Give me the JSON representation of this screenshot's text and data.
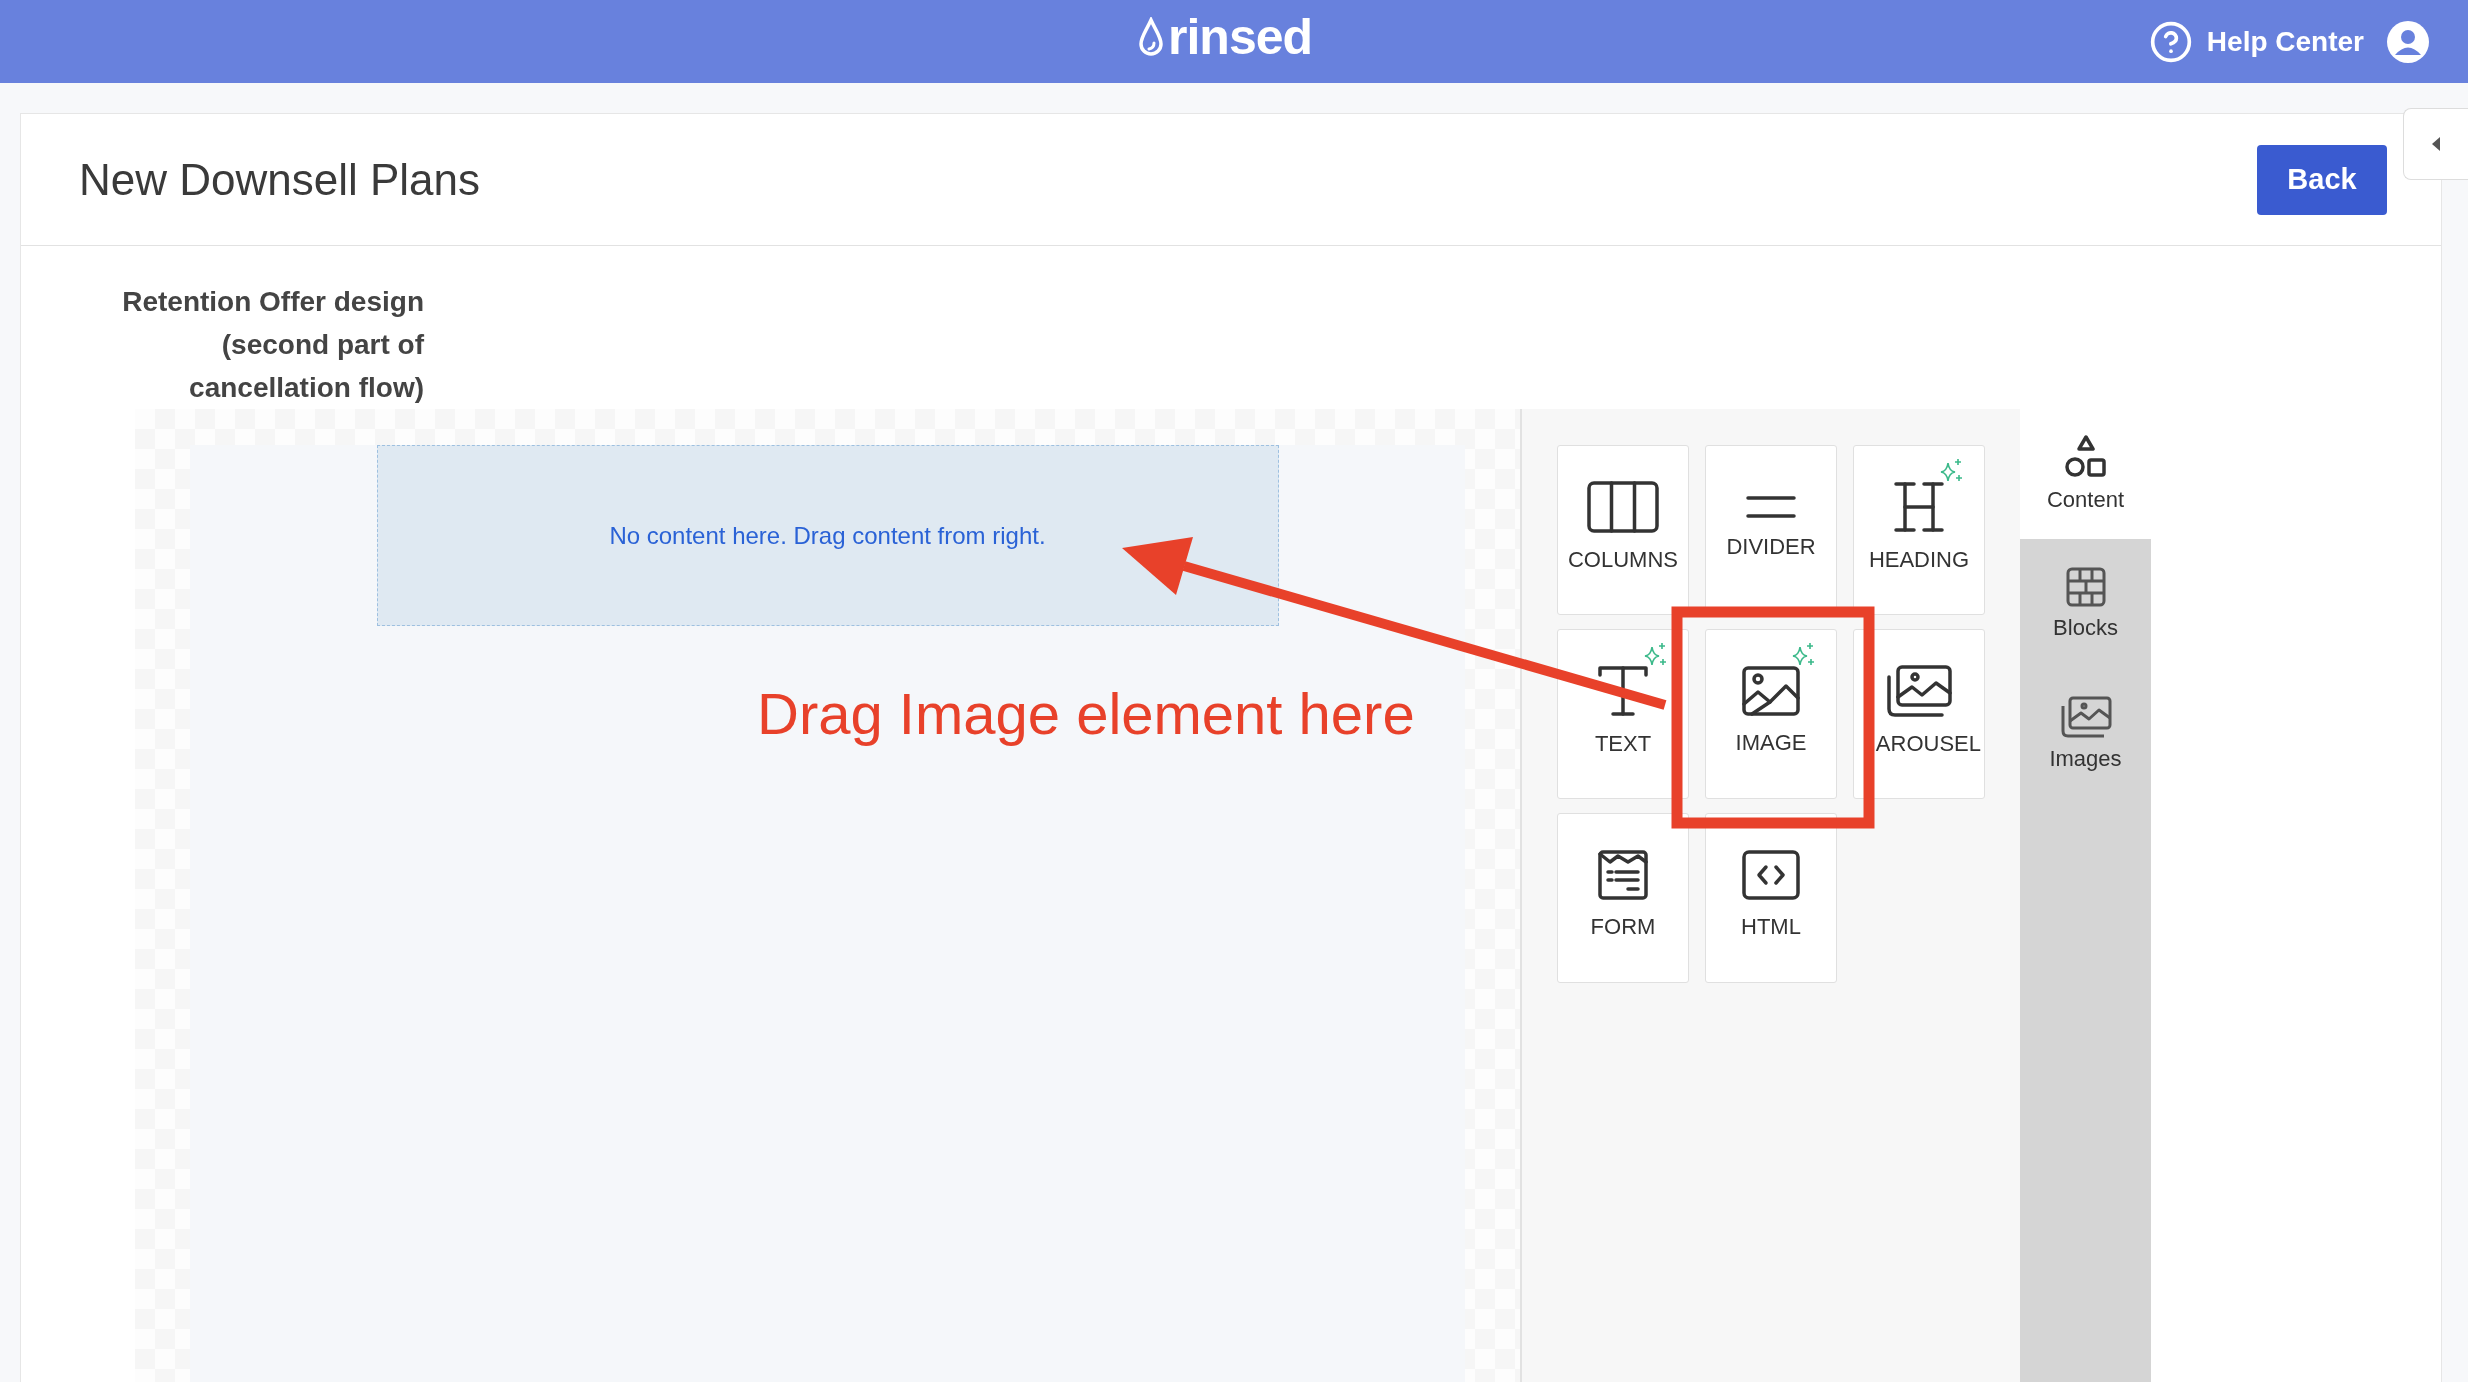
{
  "top_bar": {
    "logo": "rinsed",
    "help": "Help Center"
  },
  "header": {
    "title": "New Downsell Plans",
    "back_button": "Back"
  },
  "section_label": "Retention Offer design (second part of cancellation flow)",
  "canvas": {
    "empty_message": "No content here. Drag content from right."
  },
  "tiles": [
    {
      "kind": "columns",
      "label": "COLUMNS",
      "sparkle": false
    },
    {
      "kind": "divider",
      "label": "DIVIDER",
      "sparkle": false
    },
    {
      "kind": "heading",
      "label": "HEADING",
      "sparkle": true
    },
    {
      "kind": "text",
      "label": "TEXT",
      "sparkle": true
    },
    {
      "kind": "image",
      "label": "IMAGE",
      "sparkle": true
    },
    {
      "kind": "carousel",
      "label": "AROUSEL",
      "sparkle": false
    },
    {
      "kind": "form",
      "label": "FORM",
      "sparkle": false
    },
    {
      "kind": "html",
      "label": "HTML",
      "sparkle": false
    }
  ],
  "side_tabs": [
    {
      "kind": "content",
      "label": "Content",
      "selected": true
    },
    {
      "kind": "blocks",
      "label": "Blocks",
      "selected": false
    },
    {
      "kind": "images",
      "label": "Images",
      "selected": false
    }
  ],
  "annotation": {
    "text": "Drag Image element here"
  }
}
